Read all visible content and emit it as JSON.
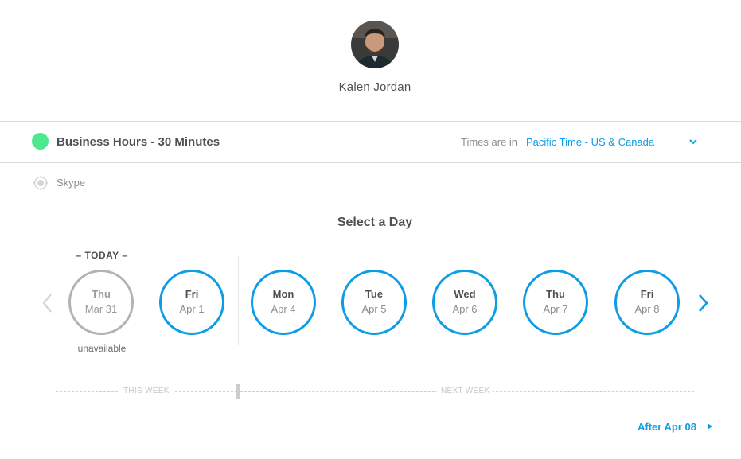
{
  "host": {
    "name": "Kalen Jordan",
    "avatar": "avatar-photo"
  },
  "event": {
    "title": "Business Hours - 30 Minutes",
    "dot_color": "#4ee88f",
    "timezone_label": "Times are in",
    "timezone_value": "Pacific Time - US & Canada",
    "timezone_icon": "chevron-down-icon"
  },
  "location": {
    "icon": "location-target-icon",
    "label": "Skype"
  },
  "calendar": {
    "title": "Select a Day",
    "today_label": "– TODAY –",
    "unavailable_label": "unavailable",
    "prev_icon": "chevron-left-icon",
    "next_icon": "chevron-right-icon",
    "days": [
      {
        "name": "Thu",
        "date": "Mar 31",
        "available": false
      },
      {
        "name": "Fri",
        "date": "Apr 1",
        "available": true
      },
      {
        "name": "Mon",
        "date": "Apr 4",
        "available": true
      },
      {
        "name": "Tue",
        "date": "Apr 5",
        "available": true
      },
      {
        "name": "Wed",
        "date": "Apr 6",
        "available": true
      },
      {
        "name": "Thu",
        "date": "Apr 7",
        "available": true
      },
      {
        "name": "Fri",
        "date": "Apr 8",
        "available": true
      }
    ],
    "week_labels": {
      "this_week": "THIS WEEK",
      "next_week": "NEXT WEEK"
    },
    "after_link": "After Apr 08"
  },
  "colors": {
    "accent": "#0e9de5",
    "unavailable_ring": "#b3b3b3",
    "text": "#4d5055",
    "muted": "#8a8d91"
  }
}
